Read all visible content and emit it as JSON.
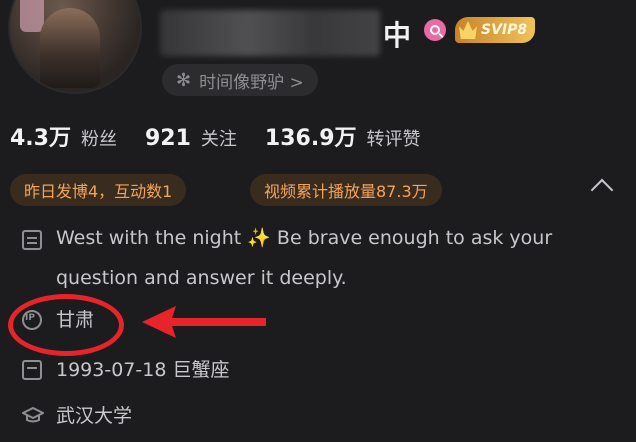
{
  "profile": {
    "name_suffix": "中",
    "svip_label": "SVIP8",
    "tag_label": "时间像野驴 >",
    "tag_icon": "snowflake-icon"
  },
  "stats": [
    {
      "num": "4.3万",
      "label": "粉丝"
    },
    {
      "num": "921",
      "label": "关注"
    },
    {
      "num": "136.9万",
      "label": "转评赞"
    }
  ],
  "chips": {
    "yesterday": "昨日发博4，互动数1",
    "video": "视频累计播放量87.3万"
  },
  "info": {
    "bio": "West with the night ✨ Be brave enough to ask your question and answer it deeply.",
    "ip_location": "甘肃",
    "birthday": "1993-07-18 巨蟹座",
    "school": "武汉大学"
  },
  "colors": {
    "background": "#1c1c1e",
    "chip_text": "#f0a55c",
    "annotation_red": "#e8242b",
    "svip_gold": "#e8a84a"
  }
}
